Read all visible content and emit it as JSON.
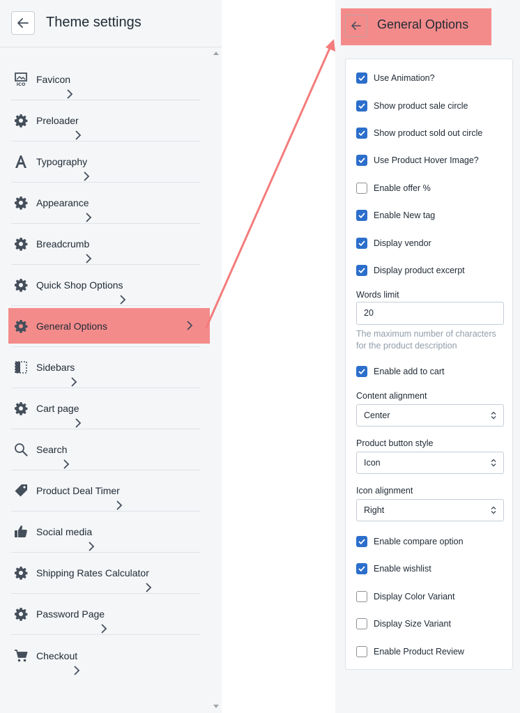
{
  "left": {
    "title": "Theme settings",
    "items": [
      {
        "label": "Favicon",
        "icon": "favicon-icon"
      },
      {
        "label": "Preloader",
        "icon": "gear-icon"
      },
      {
        "label": "Typography",
        "icon": "typography-icon"
      },
      {
        "label": "Appearance",
        "icon": "gear-icon"
      },
      {
        "label": "Breadcrumb",
        "icon": "gear-icon"
      },
      {
        "label": "Quick Shop Options",
        "icon": "gear-icon"
      },
      {
        "label": "General Options",
        "icon": "gear-icon",
        "highlighted": true
      },
      {
        "label": "Sidebars",
        "icon": "sidebar-icon"
      },
      {
        "label": "Cart page",
        "icon": "gear-icon"
      },
      {
        "label": "Search",
        "icon": "search-icon"
      },
      {
        "label": "Product Deal Timer",
        "icon": "tag-icon"
      },
      {
        "label": "Social media",
        "icon": "thumbs-up-icon"
      },
      {
        "label": "Shipping Rates Calculator",
        "icon": "gear-icon"
      },
      {
        "label": "Password Page",
        "icon": "gear-icon"
      },
      {
        "label": "Checkout",
        "icon": "cart-icon"
      }
    ]
  },
  "right": {
    "title": "General Options",
    "options": {
      "use_animation": {
        "label": "Use Animation?",
        "checked": true
      },
      "sale_circle": {
        "label": "Show product sale circle",
        "checked": true
      },
      "sold_out_circle": {
        "label": "Show product sold out circle",
        "checked": true
      },
      "hover_image": {
        "label": "Use Product Hover Image?",
        "checked": true
      },
      "offer_percent": {
        "label": "Enable offer %",
        "checked": false
      },
      "new_tag": {
        "label": "Enable New tag",
        "checked": true
      },
      "display_vendor": {
        "label": "Display vendor",
        "checked": true
      },
      "product_excerpt": {
        "label": "Display product excerpt",
        "checked": true
      },
      "add_to_cart": {
        "label": "Enable add to cart",
        "checked": true
      },
      "compare_option": {
        "label": "Enable compare option",
        "checked": true
      },
      "wishlist": {
        "label": "Enable wishlist",
        "checked": true
      },
      "color_variant": {
        "label": "Display Color Variant",
        "checked": false
      },
      "size_variant": {
        "label": "Display Size Variant",
        "checked": false
      },
      "product_review": {
        "label": "Enable Product Review",
        "checked": false
      }
    },
    "words_limit": {
      "label": "Words limit",
      "value": "20",
      "help": "The maximum number of characters for the product description"
    },
    "content_alignment": {
      "label": "Content alignment",
      "value": "Center"
    },
    "button_style": {
      "label": "Product button style",
      "value": "Icon"
    },
    "icon_alignment": {
      "label": "Icon alignment",
      "value": "Right"
    }
  },
  "colors": {
    "highlight": "#f48b8b",
    "arrow": "#f47c7c",
    "checkbox_on": "#2c6ecb"
  }
}
